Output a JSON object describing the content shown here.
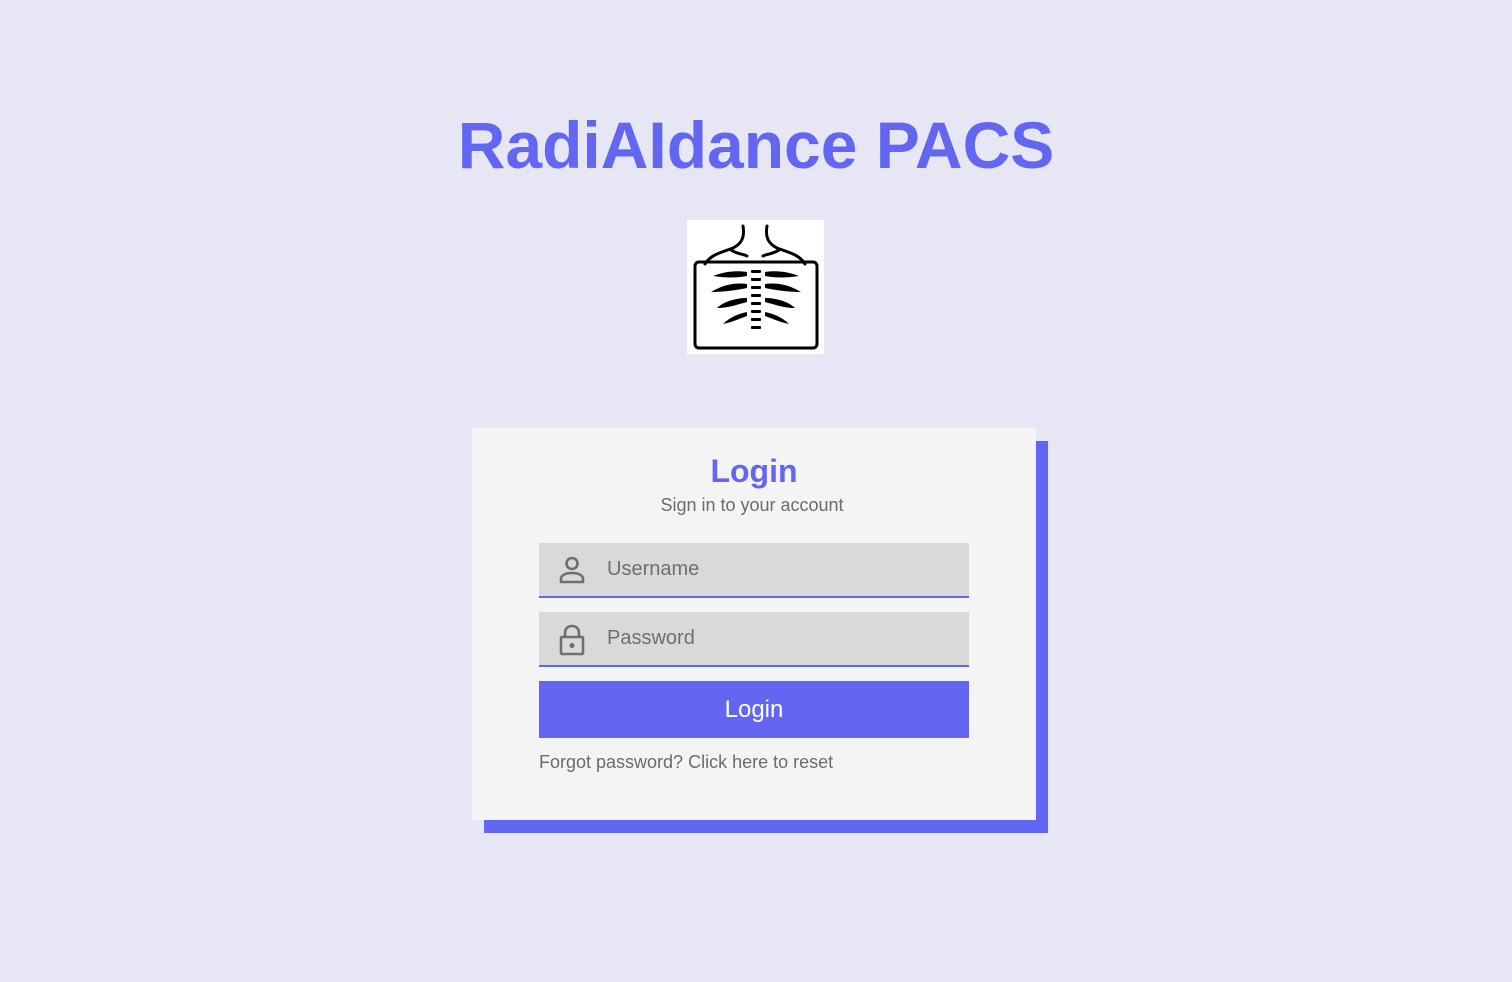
{
  "app": {
    "title": "RadiAIdance PACS"
  },
  "logo": {
    "icon": "chest-xray-icon"
  },
  "login_card": {
    "heading": "Login",
    "subtitle": "Sign in to your account",
    "username": {
      "icon": "user-icon",
      "placeholder": "Username",
      "value": ""
    },
    "password": {
      "icon": "lock-icon",
      "placeholder": "Password",
      "value": ""
    },
    "submit_label": "Login",
    "forgot_link": "Forgot password? Click here to reset"
  },
  "colors": {
    "accent": "#6366f1",
    "background": "#e6e6f4",
    "card": "#f4f4f4",
    "input": "#d9d9d9",
    "muted_text": "#6b6b6b"
  }
}
